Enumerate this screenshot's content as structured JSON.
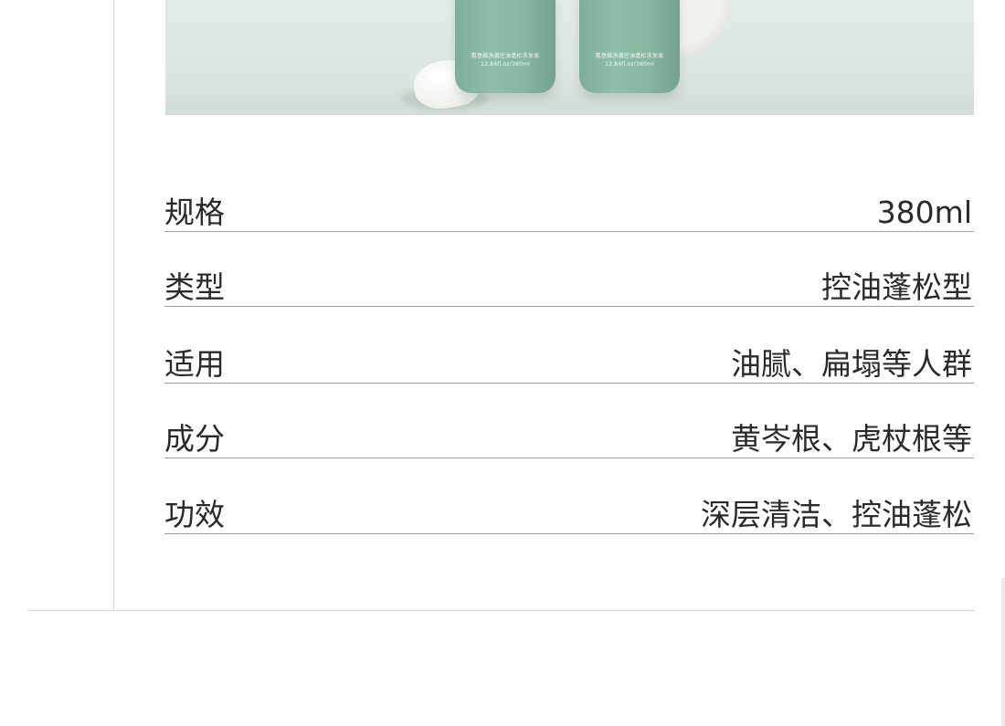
{
  "banner": {
    "bottle_label_line1": "氨基酸净澈控油蓬松洗发液",
    "bottle_label_line2": "12.84fl.oz/380ml",
    "colors": {
      "bottle": "#86b69f",
      "background": "#e0e8e3"
    }
  },
  "specs": [
    {
      "label": "规格",
      "value": "380ml"
    },
    {
      "label": "类型",
      "value": "控油蓬松型"
    },
    {
      "label": "适用",
      "value": "油腻、扁塌等人群"
    },
    {
      "label": "成分",
      "value": "黄岑根、虎杖根等"
    },
    {
      "label": "功效",
      "value": "深层清洁、控油蓬松"
    }
  ],
  "colors": {
    "text": "#2a2a2a",
    "divider": "#9e9e9e"
  }
}
